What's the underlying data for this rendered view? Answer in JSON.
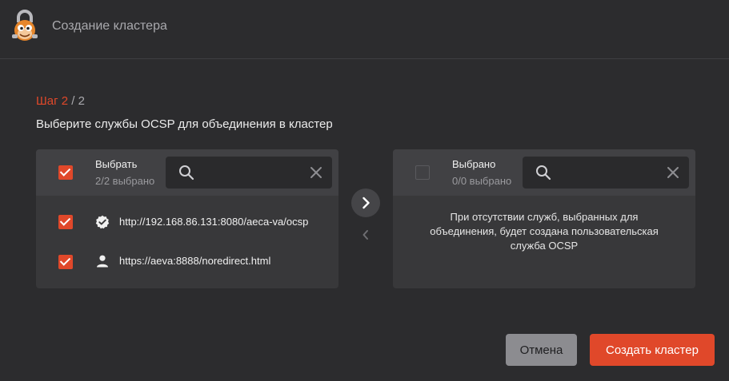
{
  "header": {
    "title": "Создание кластера",
    "logo_icon": "lock-mascot-icon"
  },
  "step": {
    "label": "Шаг",
    "current": "2",
    "separator": "/",
    "total": "2"
  },
  "subtitle": "Выберите службы OCSP для объединения в кластер",
  "source_panel": {
    "select_all_checked": true,
    "label": "Выбрать",
    "count": "2/2 выбрано",
    "search": {
      "value": "",
      "placeholder": ""
    },
    "items": [
      {
        "text": "http://192.168.86.131:8080/aeca-va/ocsp",
        "icon": "verified-badge-icon",
        "checked": true
      },
      {
        "text": "https://aeva:8888/noredirect.html",
        "icon": "user-icon",
        "checked": true
      }
    ]
  },
  "target_panel": {
    "select_all_checked": false,
    "label": "Выбрано",
    "count": "0/0 выбрано",
    "search": {
      "value": "",
      "placeholder": ""
    },
    "empty_message": "При отсутствии служб, выбранных для объединения, будет создана пользовательская служба OCSP"
  },
  "transfer": {
    "move_right_icon": "chevron-right-icon",
    "move_left_icon": "chevron-left-icon"
  },
  "footer": {
    "cancel_label": "Отмена",
    "create_label": "Создать кластер"
  },
  "colors": {
    "accent": "#e0482a",
    "background": "#2c2c2e",
    "panel": "#38383a",
    "panel_header": "#414144"
  }
}
